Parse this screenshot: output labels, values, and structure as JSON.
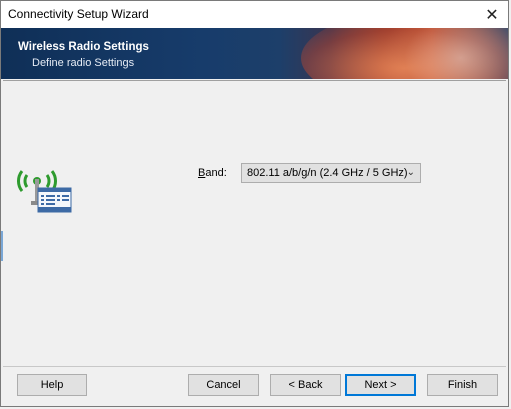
{
  "window": {
    "title": "Connectivity Setup Wizard",
    "close_glyph": "✕"
  },
  "banner": {
    "title": "Wireless Radio Settings",
    "subtitle": "Define radio Settings"
  },
  "band": {
    "label_prefix": "B",
    "label_rest": "and:",
    "selected": "802.11 a/b/g/n (2.4 GHz / 5 GHz)"
  },
  "buttons": {
    "help": "Help",
    "cancel": "Cancel",
    "back": "< Back",
    "next": "Next >",
    "finish": "Finish"
  },
  "icons": {
    "wizard": "wireless-settings-icon",
    "dropdown": "chevron-down-icon"
  },
  "colors": {
    "banner_dark": "#173c6b",
    "banner_accent": "#c9522c",
    "default_button_border": "#0078d7"
  }
}
